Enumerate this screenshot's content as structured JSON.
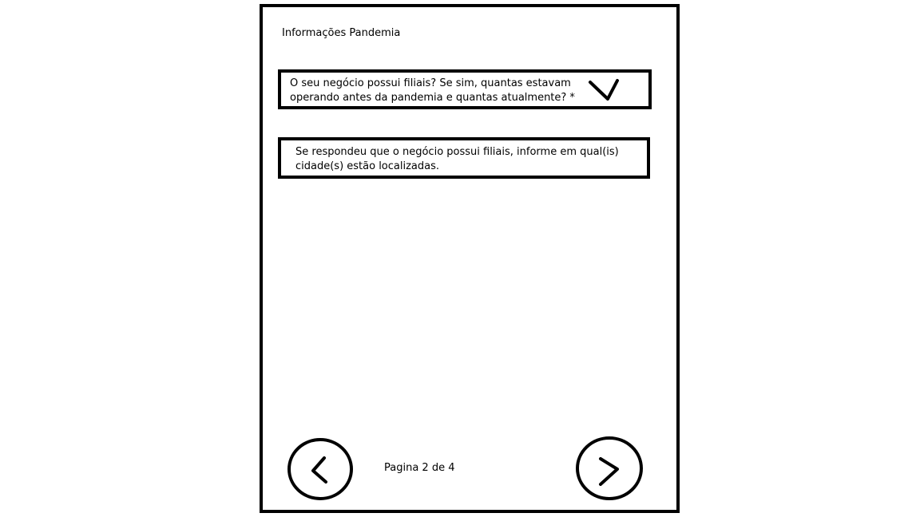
{
  "form": {
    "title": "Informações Pandemia",
    "fields": [
      {
        "label_line1": "O seu negócio possui filiais? Se sim, quantas estavam",
        "label_line2": "operando antes da pandemia e quantas atualmente? *",
        "icon": "chevron-down-icon"
      },
      {
        "label_line1": "Se respondeu que o negócio possui filiais, informe em qual(is)",
        "label_line2": "cidade(s) estão localizadas."
      }
    ],
    "pagination": {
      "text": "Pagina 2 de 4",
      "prev_icon": "chevron-left-icon",
      "next_icon": "chevron-right-icon"
    }
  }
}
